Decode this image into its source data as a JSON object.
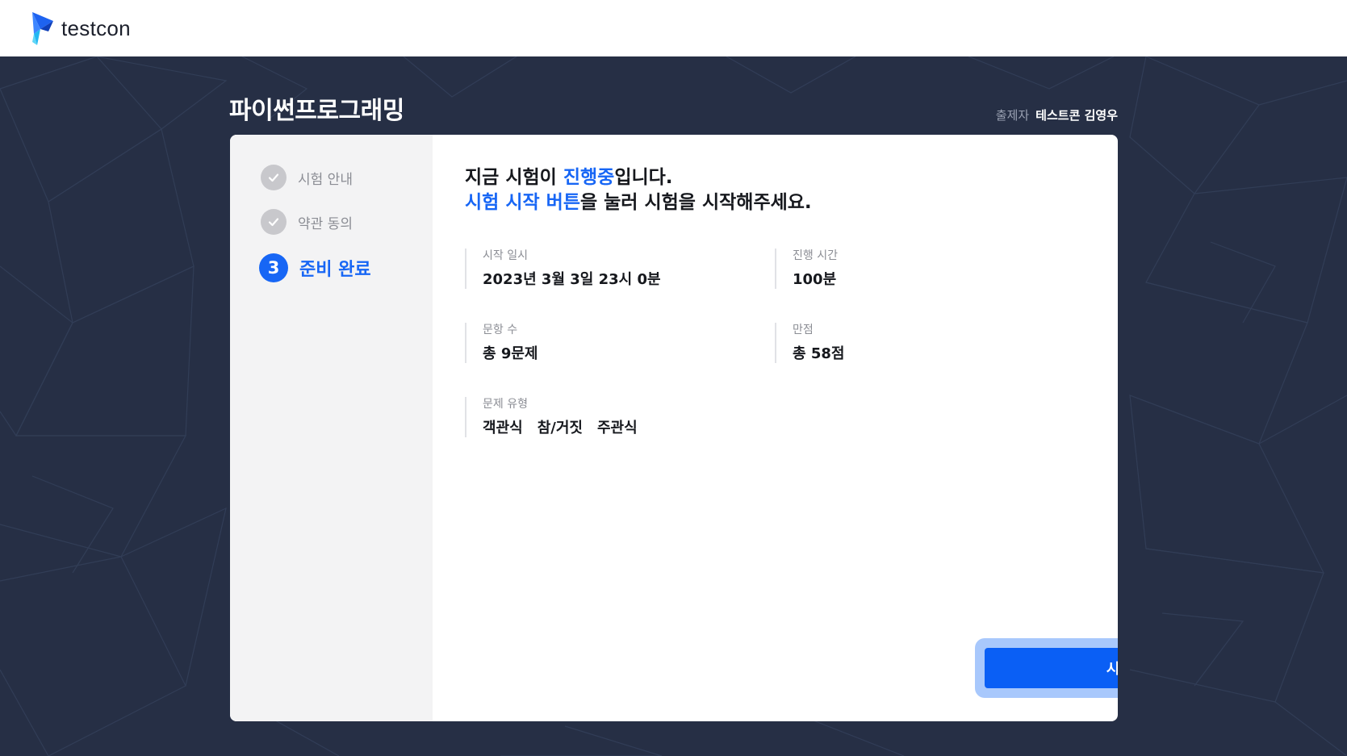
{
  "brand": {
    "name": "testcon"
  },
  "exam": {
    "title": "파이썬프로그래밍",
    "author_label": "출제자",
    "author_name": "테스트콘 김영우"
  },
  "steps": [
    {
      "label": "시험 안내",
      "status": "done"
    },
    {
      "label": "약관 동의",
      "status": "done"
    },
    {
      "number": "3",
      "label": "준비 완료",
      "status": "current"
    }
  ],
  "headline": {
    "line1_prefix": "지금 시험이 ",
    "line1_highlight": "진행중",
    "line1_suffix": "입니다.",
    "line2_highlight": "시험 시작 버튼",
    "line2_suffix": "을 눌러 시험을 시작해주세요."
  },
  "info": {
    "start_time": {
      "label": "시작 일시",
      "value": "2023년 3월 3일 23시 0분"
    },
    "duration": {
      "label": "진행 시간",
      "value": "100분"
    },
    "question_count": {
      "label": "문항 수",
      "value": "총 9문제"
    },
    "max_score": {
      "label": "만점",
      "value": "총 58점"
    },
    "question_types": {
      "label": "문제 유형",
      "values": [
        "객관식",
        "참/거짓",
        "주관식"
      ]
    }
  },
  "start_button": {
    "label": "시험 시작"
  },
  "colors": {
    "accent": "#1766f5",
    "background": "#262f45",
    "button": "#0a5ff5",
    "button_glow": "#a8c8fc"
  }
}
